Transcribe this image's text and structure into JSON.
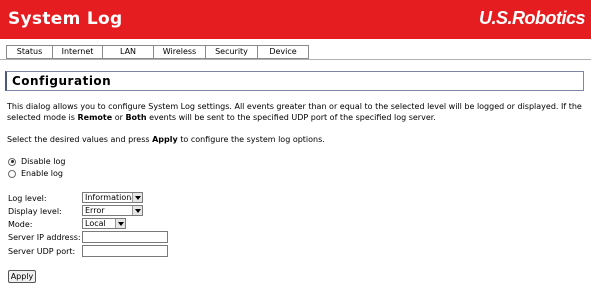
{
  "header": {
    "title": "System Log",
    "brand": "U.S.Robotics"
  },
  "tabs": [
    {
      "label": "Status"
    },
    {
      "label": "Internet"
    },
    {
      "label": "LAN"
    },
    {
      "label": "Wireless"
    },
    {
      "label": "Security"
    },
    {
      "label": "Device"
    }
  ],
  "section": {
    "title": "Configuration"
  },
  "description": {
    "part1": "This dialog allows you to configure System Log settings. All events greater than or equal to the selected level will be logged or displayed. If the selected mode is ",
    "remote": "Remote",
    "or": " or ",
    "both": "Both",
    "part2": " events will be sent to the specified UDP port of the specified log server."
  },
  "instruction": {
    "part1": "Select the desired values and press ",
    "apply_word": "Apply",
    "part2": " to configure the system log options."
  },
  "log_mode": {
    "options": [
      {
        "label": "Disable log",
        "checked": true
      },
      {
        "label": "Enable log",
        "checked": false
      }
    ]
  },
  "form": {
    "log_level": {
      "label": "Log level:",
      "value": "Informational"
    },
    "display_level": {
      "label": "Display level:",
      "value": "Error"
    },
    "mode": {
      "label": "Mode:",
      "value": "Local"
    },
    "server_ip": {
      "label": "Server IP address:",
      "value": ""
    },
    "server_port": {
      "label": "Server UDP port:",
      "value": ""
    }
  },
  "buttons": {
    "apply": "Apply"
  },
  "colors": {
    "header_bg": "#e51d20",
    "section_border": "#4b577f"
  }
}
